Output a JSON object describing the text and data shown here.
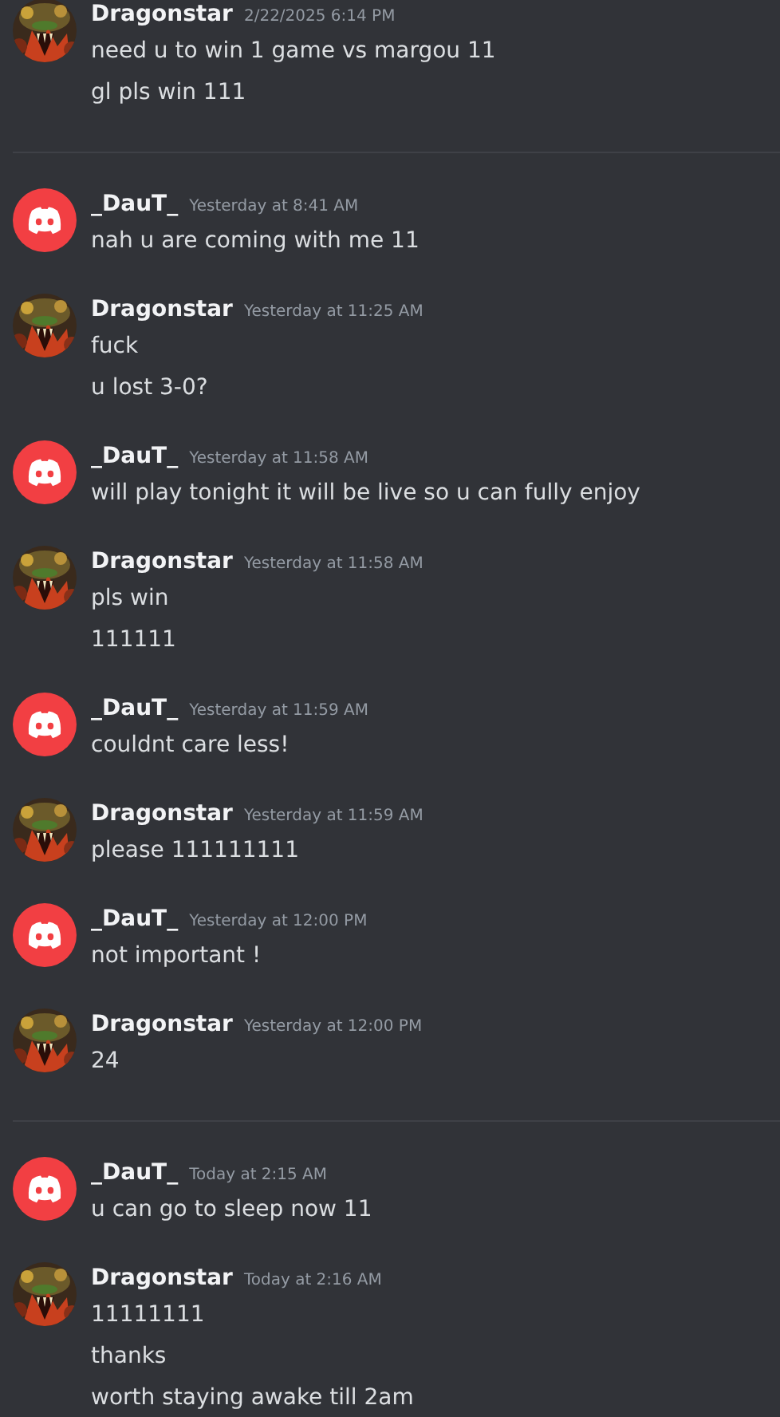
{
  "messages": [
    {
      "kind": "group",
      "avatar": {
        "kind": "picture"
      },
      "author": "Dragonstar",
      "timestamp": "2/22/2025 6:14 PM",
      "lines": [
        "need u to win 1 game vs margou 11",
        "gl pls win 111"
      ]
    },
    {
      "kind": "divider"
    },
    {
      "kind": "group",
      "avatar": {
        "kind": "logo"
      },
      "author": "_DauT_",
      "timestamp": "Yesterday at 8:41 AM",
      "lines": [
        "nah u are coming with me 11"
      ]
    },
    {
      "kind": "group",
      "avatar": {
        "kind": "picture"
      },
      "author": "Dragonstar",
      "timestamp": "Yesterday at 11:25 AM",
      "lines": [
        "fuck",
        "u lost 3-0?"
      ]
    },
    {
      "kind": "group",
      "avatar": {
        "kind": "logo"
      },
      "author": "_DauT_",
      "timestamp": "Yesterday at 11:58 AM",
      "lines": [
        "will play tonight it will be live so u can fully enjoy"
      ]
    },
    {
      "kind": "group",
      "avatar": {
        "kind": "picture"
      },
      "author": "Dragonstar",
      "timestamp": "Yesterday at 11:58 AM",
      "lines": [
        "pls win",
        "111111"
      ]
    },
    {
      "kind": "group",
      "avatar": {
        "kind": "logo"
      },
      "author": "_DauT_",
      "timestamp": "Yesterday at 11:59 AM",
      "lines": [
        "couldnt care less!"
      ]
    },
    {
      "kind": "group",
      "avatar": {
        "kind": "picture"
      },
      "author": "Dragonstar",
      "timestamp": "Yesterday at 11:59 AM",
      "lines": [
        "please 111111111"
      ]
    },
    {
      "kind": "group",
      "avatar": {
        "kind": "logo"
      },
      "author": "_DauT_",
      "timestamp": "Yesterday at 12:00 PM",
      "lines": [
        "not important !"
      ]
    },
    {
      "kind": "group",
      "avatar": {
        "kind": "picture"
      },
      "author": "Dragonstar",
      "timestamp": "Yesterday at 12:00 PM",
      "lines": [
        "24"
      ]
    },
    {
      "kind": "divider"
    },
    {
      "kind": "group",
      "avatar": {
        "kind": "logo"
      },
      "author": "_DauT_",
      "timestamp": "Today at 2:15 AM",
      "lines": [
        "u can go to sleep now 11"
      ]
    },
    {
      "kind": "group",
      "avatar": {
        "kind": "picture"
      },
      "author": "Dragonstar",
      "timestamp": "Today at 2:16 AM",
      "lines": [
        "11111111",
        "thanks",
        "worth staying awake till 2am"
      ]
    }
  ]
}
